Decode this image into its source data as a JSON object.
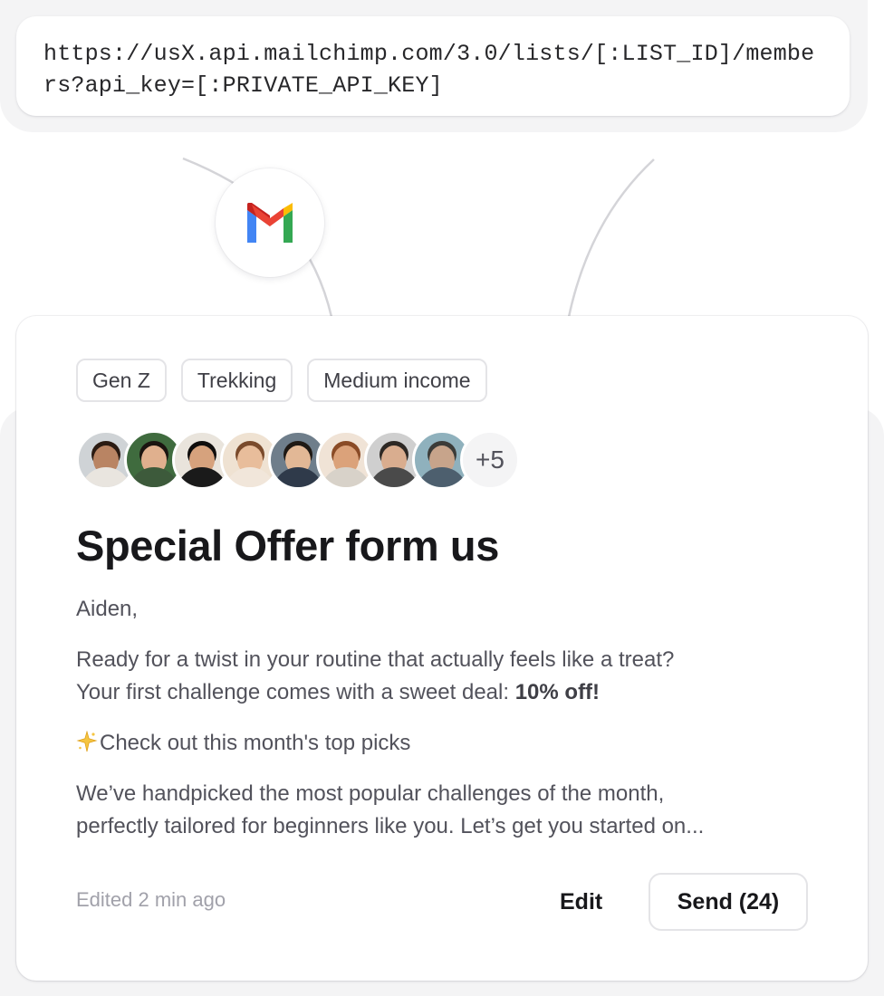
{
  "api_request": {
    "url": "https://usX.api.mailchimp.com/3.0/lists/[:LIST_ID]/members?api_key=[:PRIVATE_API_KEY]"
  },
  "integration": {
    "icon": "gmail-logo-icon"
  },
  "campaign": {
    "tags": [
      "Gen Z",
      "Trekking",
      "Medium income"
    ],
    "recipients": {
      "avatars": [
        {
          "name": "avatar-1",
          "skin": "#b98463",
          "hair": "#2b1b12",
          "shirt": "#e9e5df",
          "bg": "#cfd3d6"
        },
        {
          "name": "avatar-2",
          "skin": "#e0b08e",
          "hair": "#1b1410",
          "shirt": "#3d5a3b",
          "bg": "#3f6b3e"
        },
        {
          "name": "avatar-3",
          "skin": "#d6a27d",
          "hair": "#0f0d0c",
          "shirt": "#1a1a1a",
          "bg": "#e9e4dc"
        },
        {
          "name": "avatar-4",
          "skin": "#e8bd9b",
          "hair": "#7a4a2b",
          "shirt": "#f1e6da",
          "bg": "#efe2d2"
        },
        {
          "name": "avatar-5",
          "skin": "#e2b896",
          "hair": "#1f1914",
          "shirt": "#2f3a4a",
          "bg": "#6f7e8b"
        },
        {
          "name": "avatar-6",
          "skin": "#dba27a",
          "hair": "#8a4b26",
          "shirt": "#d8d2c9",
          "bg": "#f0e3d6"
        },
        {
          "name": "avatar-7",
          "skin": "#d9ad8f",
          "hair": "#2d2824",
          "shirt": "#4a4a4a",
          "bg": "#cfcfcf"
        },
        {
          "name": "avatar-8",
          "skin": "#c7a48b",
          "hair": "#3b3b38",
          "shirt": "#4d5f6e",
          "bg": "#8fb1bd"
        }
      ],
      "overflow_label": "+5"
    },
    "title": "Special Offer form us",
    "greeting": "Aiden,",
    "intro_line1": "Ready for a twist in your routine that actually feels like a treat?",
    "intro_line2_prefix": "Your first challenge comes with a sweet deal: ",
    "intro_line2_bold": "10% off!",
    "highlight_icon": "sparkle-icon",
    "highlight_text": "Check out this month's top picks",
    "description_line1": "We’ve handpicked the most popular challenges of the month,",
    "description_line2": "perfectly tailored for beginners like you. Let’s get you started on...",
    "edited_status": "Edited 2 min ago",
    "edit_label": "Edit",
    "send_label": "Send (24)"
  }
}
